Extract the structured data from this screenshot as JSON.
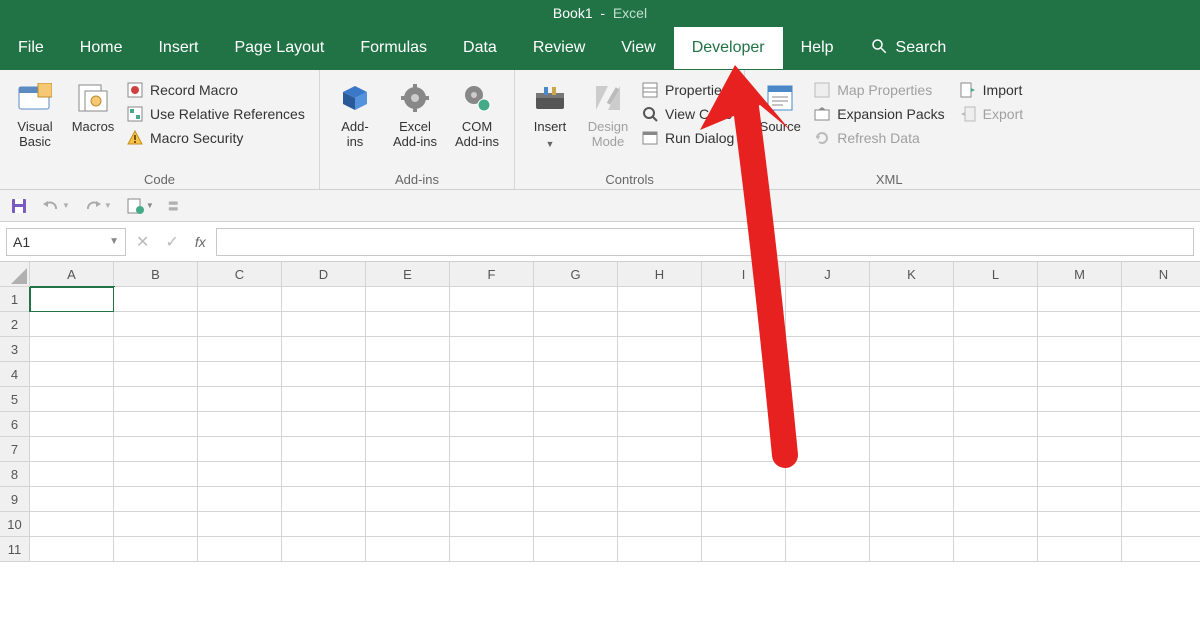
{
  "title": {
    "book": "Book1",
    "app": "Excel"
  },
  "tabs": {
    "file": "File",
    "home": "Home",
    "insert": "Insert",
    "page_layout": "Page Layout",
    "formulas": "Formulas",
    "data": "Data",
    "review": "Review",
    "view": "View",
    "developer": "Developer",
    "help": "Help",
    "search": "Search"
  },
  "ribbon": {
    "code": {
      "visual_basic": "Visual\nBasic",
      "macros": "Macros",
      "record_macro": "Record Macro",
      "use_rel_refs": "Use Relative References",
      "macro_security": "Macro Security",
      "label": "Code"
    },
    "addins": {
      "addins": "Add-\nins",
      "excel_addins": "Excel\nAdd-ins",
      "com_addins": "COM\nAdd-ins",
      "label": "Add-ins"
    },
    "controls": {
      "insert": "Insert",
      "design_mode": "Design\nMode",
      "properties": "Properties",
      "view_code": "View Code",
      "run_dialog": "Run Dialog",
      "label": "Controls"
    },
    "xml": {
      "source": "Source",
      "map_properties": "Map Properties",
      "expansion_packs": "Expansion Packs",
      "refresh_data": "Refresh Data",
      "import": "Import",
      "export": "Export",
      "label": "XML"
    }
  },
  "namebox": "A1",
  "columns": [
    "A",
    "B",
    "C",
    "D",
    "E",
    "F",
    "G",
    "H",
    "I",
    "J",
    "K",
    "L",
    "M",
    "N"
  ],
  "rows": [
    "1",
    "2",
    "3",
    "4",
    "5",
    "6",
    "7",
    "8",
    "9",
    "10",
    "11"
  ]
}
